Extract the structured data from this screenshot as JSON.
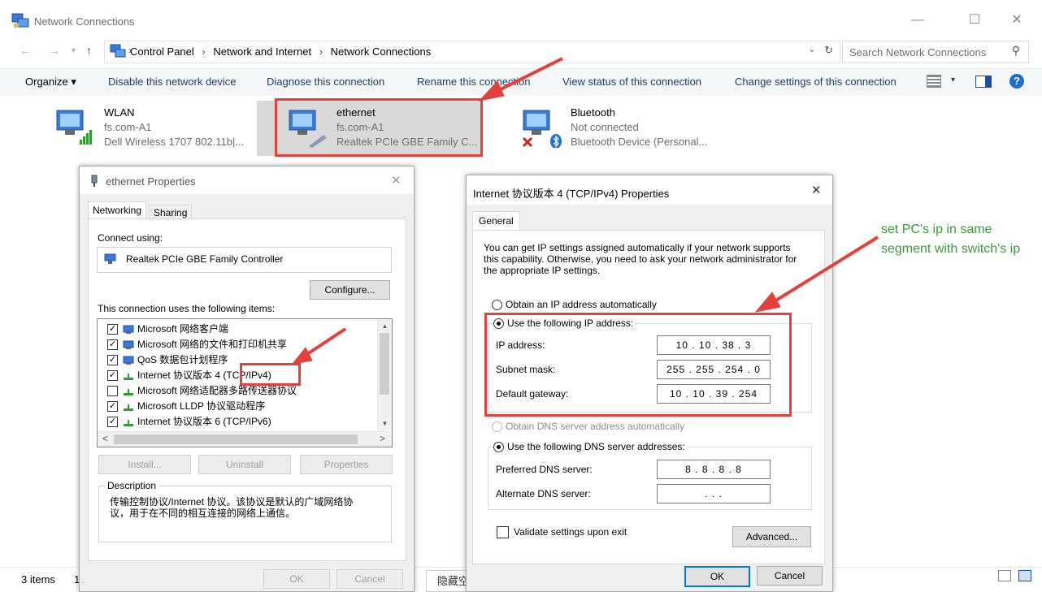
{
  "window": {
    "title": "Network Connections",
    "min": "—",
    "max": "☐",
    "close": "✕"
  },
  "address": {
    "crumbs": [
      "Control Panel",
      "Network and Internet",
      "Network Connections"
    ],
    "search_placeholder": "Search Network Connections"
  },
  "toolbar": {
    "organize": "Organize ▾",
    "disable": "Disable this network device",
    "diagnose": "Diagnose this connection",
    "rename": "Rename this connection",
    "status": "View status of this connection",
    "change": "Change settings of this connection"
  },
  "connections": [
    {
      "name": "WLAN",
      "sub": "fs.com-A1",
      "device": "Dell Wireless 1707 802.11b|..."
    },
    {
      "name": "ethernet",
      "sub": "fs.com-A1",
      "device": "Realtek PCIe GBE Family C..."
    },
    {
      "name": "Bluetooth",
      "sub": "Not connected",
      "device": "Bluetooth Device (Personal..."
    }
  ],
  "status_bar": {
    "items": "3 items",
    "extra": "1"
  },
  "eth_dialog": {
    "title": "ethernet Properties",
    "close": "✕",
    "tabs": [
      "Networking",
      "Sharing"
    ],
    "connect_using_label": "Connect using:",
    "adapter": "Realtek PCIe GBE Family Controller",
    "configure": "Configure...",
    "items_label": "This connection uses the following items:",
    "items": [
      {
        "label": "Microsoft 网络客户端",
        "checked": true
      },
      {
        "label": "Microsoft 网络的文件和打印机共享",
        "checked": true
      },
      {
        "label": "QoS 数据包计划程序",
        "checked": true
      },
      {
        "label": "Internet 协议版本 4 (TCP/IPv4)",
        "checked": true
      },
      {
        "label": "Microsoft 网络适配器多路传送器协议",
        "checked": false
      },
      {
        "label": "Microsoft LLDP 协议驱动程序",
        "checked": true
      },
      {
        "label": "Internet 协议版本 6 (TCP/IPv6)",
        "checked": true
      }
    ],
    "install": "Install...",
    "uninstall": "Uninstall",
    "properties": "Properties",
    "description_label": "Description",
    "description": "传输控制协议/Internet 协议。该协议是默认的广域网络协议，用于在不同的相互连接的网络上通信。",
    "ok": "OK",
    "cancel": "Cancel",
    "check_mark": "✓",
    "scroll_up": "▲",
    "scroll_down": "▼",
    "scroll_left": "<",
    "scroll_right": ">"
  },
  "ip_dialog": {
    "title": "Internet 协议版本 4 (TCP/IPv4) Properties",
    "close": "✕",
    "tab": "General",
    "info": "You can get IP settings assigned automatically if your network supports this capability. Otherwise, you need to ask your network administrator for the appropriate IP settings.",
    "auto_ip": "Obtain an IP address automatically",
    "manual_ip": "Use the following IP address:",
    "ip_label": "IP address:",
    "ip_value": "10 . 10 . 38 . 3",
    "mask_label": "Subnet mask:",
    "mask_value": "255 . 255 . 254 . 0",
    "gateway_label": "Default gateway:",
    "gateway_value": "10 . 10 . 39 . 254",
    "auto_dns": "Obtain DNS server address automatically",
    "manual_dns": "Use the following DNS server addresses:",
    "pref_dns_label": "Preferred DNS server:",
    "pref_dns_value": "8 . 8 . 8 . 8",
    "alt_dns_label": "Alternate DNS server:",
    "alt_dns_value": ". . .",
    "validate": "Validate settings upon exit",
    "advanced": "Advanced...",
    "ok": "OK",
    "cancel": "Cancel"
  },
  "annotation": "set PC's ip in same segment with switch's ip",
  "ime": "隐藏空白",
  "colors": {
    "annotation_red": "#e3413b",
    "annotation_green": "#3a9a3a",
    "link_blue": "#1e3e64"
  }
}
